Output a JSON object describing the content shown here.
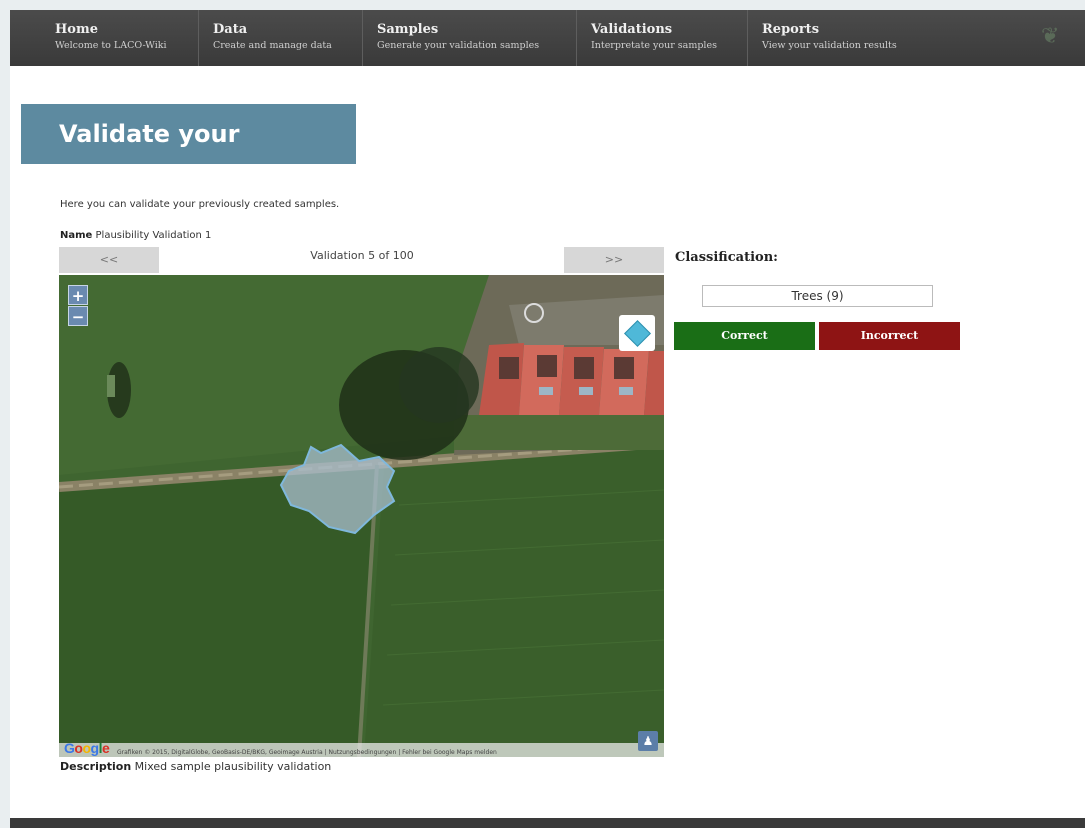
{
  "nav": [
    {
      "title": "Home",
      "subtitle": "Welcome to LACO-Wiki"
    },
    {
      "title": "Data",
      "subtitle": "Create and manage data"
    },
    {
      "title": "Samples",
      "subtitle": "Generate your validation samples"
    },
    {
      "title": "Validations",
      "subtitle": "Interpretate your samples"
    },
    {
      "title": "Reports",
      "subtitle": "View your validation results"
    }
  ],
  "page": {
    "title": "Validate your Samples",
    "intro": "Here you can validate your previously created samples.",
    "name_label": "Name",
    "name_value": "Plausibility Validation 1",
    "prev_label": "<<",
    "next_label": ">>",
    "counter": "Validation 5 of 100",
    "description_label": "Description",
    "description_value": "Mixed sample plausibility validation"
  },
  "map": {
    "zoom_in": "+",
    "zoom_out": "−",
    "attribution": "Grafiken © 2015, DigitalGlobe, GeoBasis-DE/BKG, Geoimage Austria | Nutzungsbedingungen | Fehler bei Google Maps melden",
    "logo_letters": [
      "G",
      "o",
      "o",
      "g",
      "l",
      "e"
    ]
  },
  "classification": {
    "label": "Classification:",
    "value": "Trees (9)",
    "correct_label": "Correct",
    "incorrect_label": "Incorrect"
  }
}
